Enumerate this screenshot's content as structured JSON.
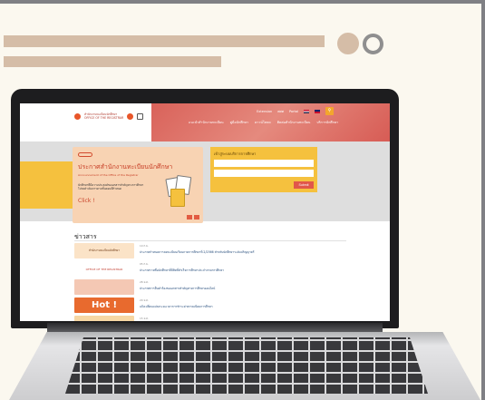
{
  "site": {
    "logo": {
      "line1": "สำนักงานทะเบียนนักศึกษา",
      "line2": "OFFICE OF THE REGISTRAR"
    },
    "topbar": [
      "Extension",
      "ศศศ",
      "Portal"
    ],
    "nav": [
      "แนะนำสำนักงานทะเบียน",
      "คู่มือนักศึกษา",
      "ดาวน์โหลด",
      "ติดต่อสำนักงานทะเบียน",
      "บริการนักศึกษา"
    ],
    "hero": {
      "title": "ประกาศสำนักงานทะเบียนนักศึกษา",
      "subtitle": "Announcement of the Office of the Registrar",
      "body": "นักศึกษาที่มีความประสงค์ขอเอกสารสำคัญทางการศึกษา โปรดดำเนินการตามขั้นตอนที่กำหนด",
      "click": "Click !"
    },
    "login": {
      "title": "เข้าสู่ระบบบริการการศึกษา",
      "button": "Submit"
    },
    "news": {
      "heading": "ข่าวสาร",
      "items": [
        {
          "thumb": "สำนักงานทะเบียนนักศึกษา",
          "date": "10 ก.พ.",
          "title": "ประกาศกำหนดการลงทะเบียนเรียนภาคการศึกษาที่ 2/2566 สำหรับนักศึกษาระดับปริญญาตรี"
        },
        {
          "thumb": "OFFICE OF THE REGISTRAR",
          "date": "05 ก.พ.",
          "title": "ประกาศรายชื่อนักศึกษาที่มีสิทธิ์สำเร็จการศึกษาประจำภาคการศึกษา"
        },
        {
          "thumb": "",
          "date": "28 ม.ค.",
          "title": "ประกาศการยื่นคำร้องขอเอกสารสำคัญทางการศึกษาออนไลน์"
        },
        {
          "thumb": "Hot !",
          "date": "20 ม.ค.",
          "title": "แจ้งเปลี่ยนแปลงระยะเวลาการชำระค่าธรรมเนียมการศึกษา"
        },
        {
          "thumb": "",
          "date": "15 ม.ค.",
          "title": ""
        }
      ]
    }
  },
  "colors": {
    "accent": "#e1574a",
    "yellow": "#f5c13e",
    "beige": "#d5bda7"
  }
}
